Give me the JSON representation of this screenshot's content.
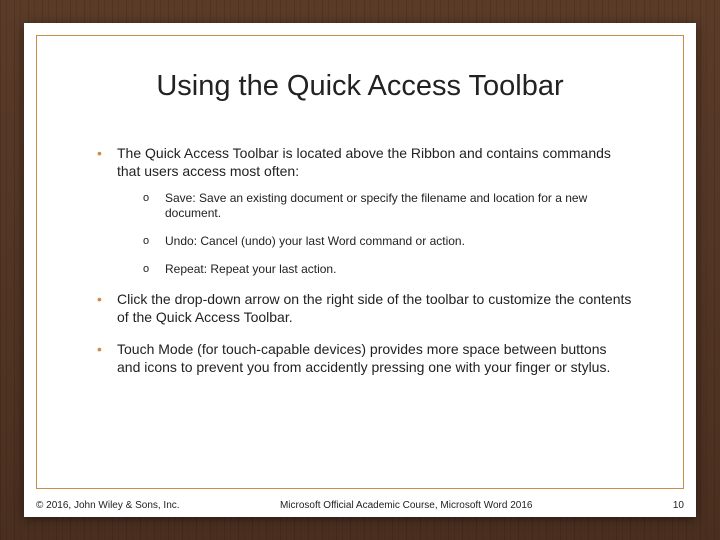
{
  "title": "Using the Quick Access Toolbar",
  "bullets": [
    {
      "text": "The Quick Access Toolbar is located above the Ribbon and contains commands that users access most often:",
      "sub": [
        "Save: Save an existing document or specify the filename and location for a new document.",
        "Undo: Cancel (undo) your last Word command or action.",
        "Repeat: Repeat your last action."
      ]
    },
    {
      "text": "Click the drop-down arrow on the right side of the toolbar to customize the contents of the Quick Access Toolbar."
    },
    {
      "text": "Touch Mode (for touch-capable devices) provides more space between buttons and icons to prevent you from accidently pressing one with your finger or stylus."
    }
  ],
  "footer": {
    "copyright": "© 2016, John Wiley & Sons, Inc.",
    "course": "Microsoft Official Academic Course, Microsoft Word 2016",
    "page": "10"
  }
}
